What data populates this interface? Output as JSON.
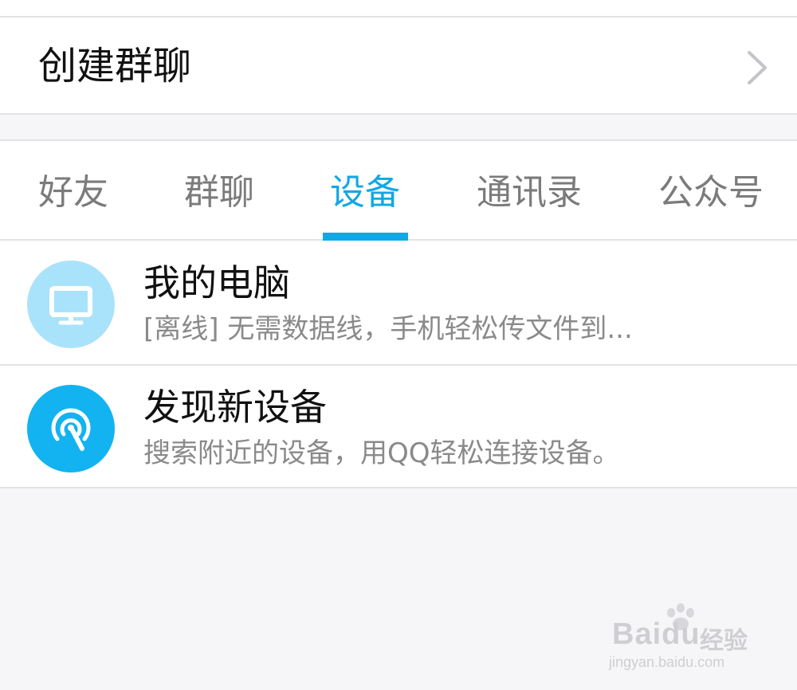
{
  "create_group": {
    "label": "创建群聊",
    "icon": "chevron-right-icon"
  },
  "tabs": [
    {
      "label": "好友",
      "active": false
    },
    {
      "label": "群聊",
      "active": false
    },
    {
      "label": "设备",
      "active": true
    },
    {
      "label": "通讯录",
      "active": false
    },
    {
      "label": "公众号",
      "active": false
    }
  ],
  "devices": [
    {
      "title": "我的电脑",
      "subtitle": "[离线] 无需数据线，手机轻松传文件到...",
      "icon": "monitor-icon",
      "icon_bg": "#a9e3fb"
    },
    {
      "title": "发现新设备",
      "subtitle": "搜索附近的设备，用QQ轻松连接设备。",
      "icon": "radar-signal-icon",
      "icon_bg": "#12b3f0"
    }
  ],
  "watermark": {
    "brand": "Baidu",
    "product": "经验",
    "url": "jingyan.baidu.com"
  },
  "colors": {
    "accent": "#12a8e5",
    "background": "#f6f6f8"
  }
}
